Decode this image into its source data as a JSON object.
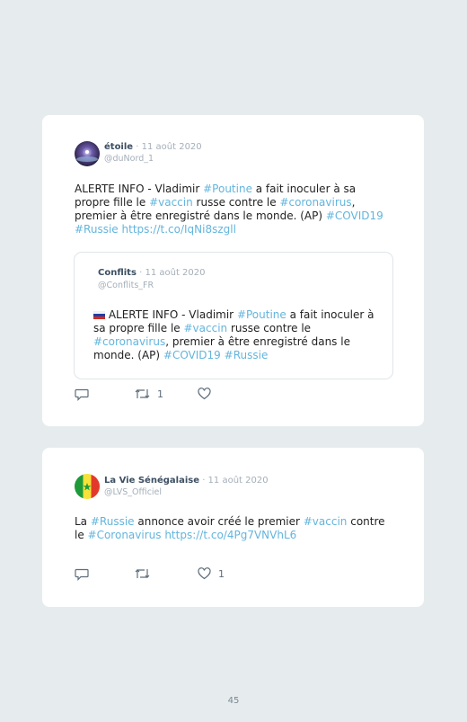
{
  "tweet1": {
    "author": "étoile",
    "date": "· 11 août 2020",
    "handle": "@duNord_1",
    "text": [
      {
        "t": "ALERTE INFO - Vladimir ",
        "tag": false
      },
      {
        "t": "#Poutine",
        "tag": true
      },
      {
        "t": " a fait inoculer à sa propre fille le ",
        "tag": false
      },
      {
        "t": "#vaccin",
        "tag": true
      },
      {
        "t": " russe contre le ",
        "tag": false
      },
      {
        "t": "#coronavirus",
        "tag": true
      },
      {
        "t": ", premier à être enregistré dans le monde. (AP) ",
        "tag": false
      },
      {
        "t": "#COVID19",
        "tag": true
      },
      {
        "t": " ",
        "tag": false
      },
      {
        "t": "#Russie",
        "tag": true
      },
      {
        "t": " https://t.co/IqNi8szgll",
        "tag": true
      }
    ],
    "quoted": {
      "author": "Conflits",
      "date": "· 11 août 2020",
      "handle": "@Conflits_FR",
      "text": [
        {
          "t": " ALERTE INFO - Vladimir ",
          "tag": false
        },
        {
          "t": "#Poutine",
          "tag": true
        },
        {
          "t": " a fait inoculer à sa propre fille le ",
          "tag": false
        },
        {
          "t": "#vaccin",
          "tag": true
        },
        {
          "t": " russe contre le ",
          "tag": false
        },
        {
          "t": "#coronavirus",
          "tag": true
        },
        {
          "t": ", premier à être enregistré dans le monde. (AP) ",
          "tag": false
        },
        {
          "t": "#COVID19",
          "tag": true
        },
        {
          "t": " ",
          "tag": false
        },
        {
          "t": "#Russie",
          "tag": true
        }
      ]
    },
    "retweets": "1",
    "likes": ""
  },
  "tweet2": {
    "author": "La Vie Sénégalaise",
    "date": "· 11 août 2020",
    "handle": "@LVS_Officiel",
    "text": [
      {
        "t": "La ",
        "tag": false
      },
      {
        "t": "#Russie",
        "tag": true
      },
      {
        "t": " annonce avoir créé le premier ",
        "tag": false
      },
      {
        "t": "#vaccin",
        "tag": true
      },
      {
        "t": " contre le ",
        "tag": false
      },
      {
        "t": "#Coronavirus",
        "tag": true
      },
      {
        "t": " https://t.co/4Pg7VNVhL6",
        "tag": true
      }
    ],
    "retweets": "",
    "likes": "1"
  },
  "page_number": "45",
  "colors": {
    "hashtag": "#63b5dd",
    "name": "#3c4f63",
    "meta": "#a4afb9",
    "background": "#e6ecee"
  },
  "icons": [
    "reply-icon",
    "retweet-icon",
    "like-icon",
    "russia-flag-icon",
    "senegal-flag-icon"
  ]
}
